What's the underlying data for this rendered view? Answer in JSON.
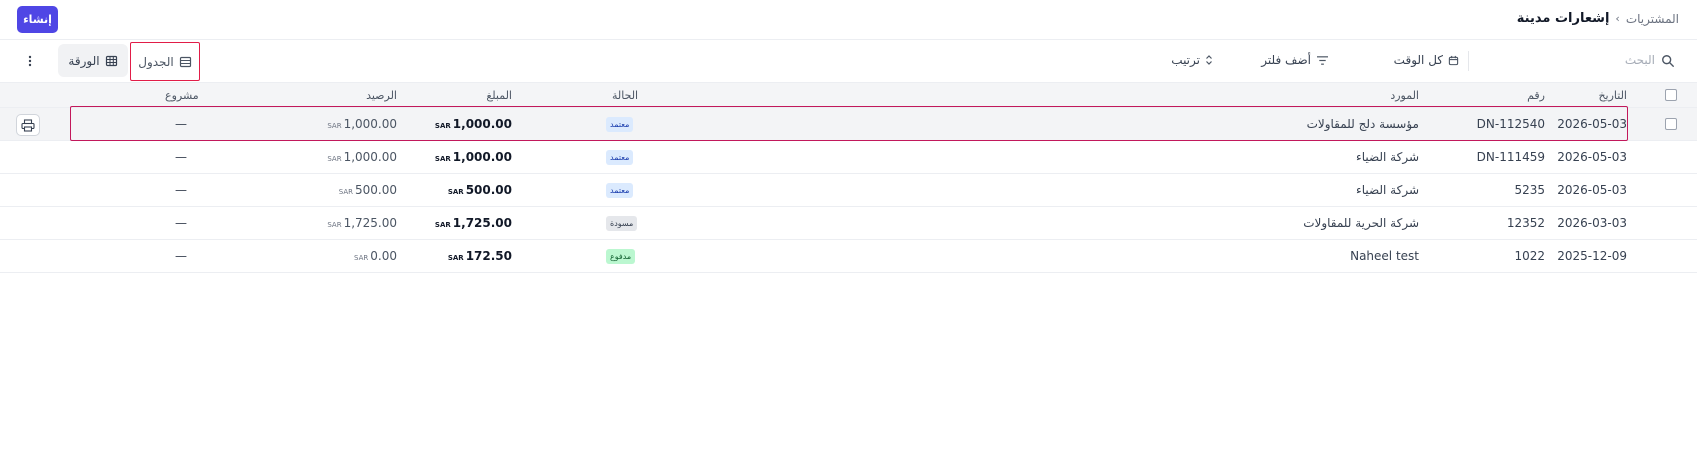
{
  "header": {
    "breadcrumb_parent": "المشتريات",
    "breadcrumb_separator": "›",
    "page_title": "إشعارات مدينة",
    "create_label": "إنشاء",
    "accent_color": "#4f46e5"
  },
  "toolbar": {
    "search_placeholder": "البحث",
    "all_time_label": "كل الوقت",
    "add_filter_label": "أضف فلتر",
    "sort_label": "ترتيب",
    "view_table_label": "الجدول",
    "view_sheet_label": "الورقة"
  },
  "table": {
    "columns": {
      "date": "التاريخ",
      "number": "رقم",
      "supplier": "المورد",
      "status": "الحالة",
      "amount": "المبلغ",
      "balance": "الرصيد",
      "project": "مشروع"
    },
    "currency": "SAR",
    "rows": [
      {
        "date": "2026-05-03",
        "number": "DN-112540",
        "supplier": "مؤسسة دلج للمقاولات",
        "status": "معتمد",
        "status_kind": "approved",
        "amount": "1,000.00",
        "balance": "1,000.00",
        "project": "—"
      },
      {
        "date": "2026-05-03",
        "number": "DN-111459",
        "supplier": "شركة الضياء",
        "status": "معتمد",
        "status_kind": "approved",
        "amount": "1,000.00",
        "balance": "1,000.00",
        "project": "—"
      },
      {
        "date": "2026-05-03",
        "number": "5235",
        "supplier": "شركة الضياء",
        "status": "معتمد",
        "status_kind": "approved",
        "amount": "500.00",
        "balance": "500.00",
        "project": "—"
      },
      {
        "date": "2026-03-03",
        "number": "12352",
        "supplier": "شركة الحرية للمقاولات",
        "status": "مسودة",
        "status_kind": "draft",
        "amount": "1,725.00",
        "balance": "1,725.00",
        "project": "—"
      },
      {
        "date": "2025-12-09",
        "number": "1022",
        "supplier": "Naheel test",
        "status": "مدفوع",
        "status_kind": "paid",
        "amount": "172.50",
        "balance": "0.00",
        "project": "—"
      }
    ]
  }
}
